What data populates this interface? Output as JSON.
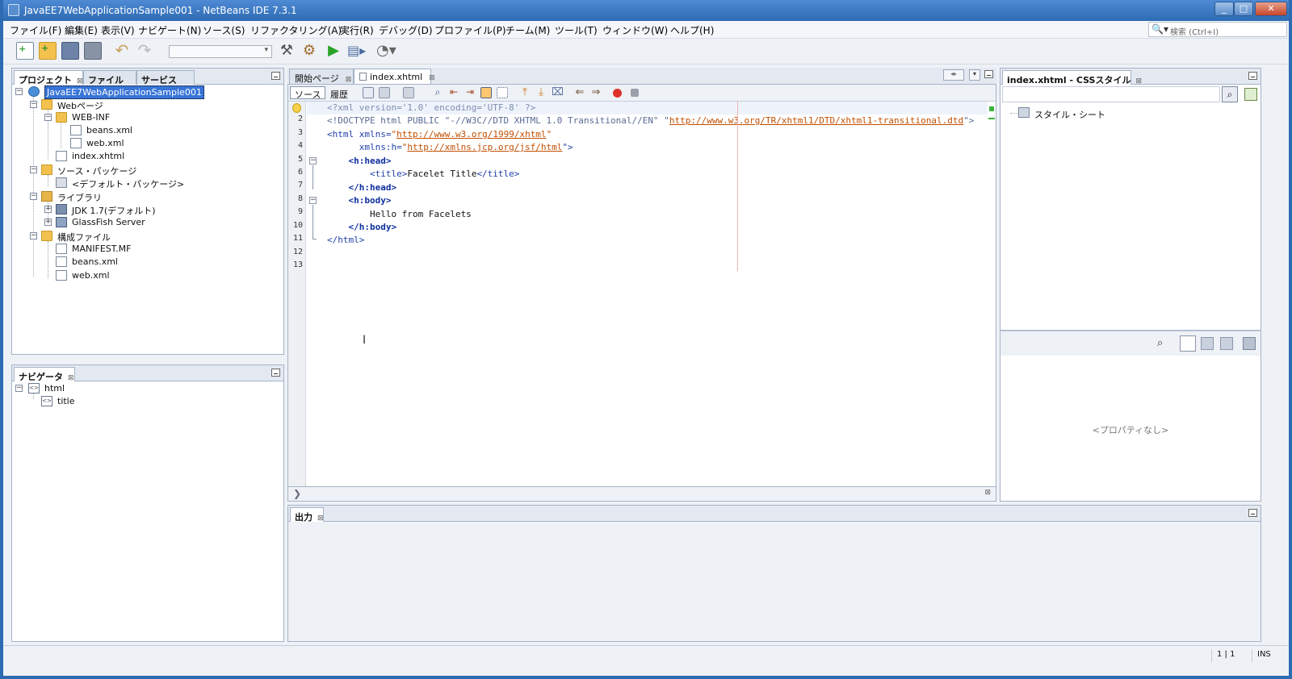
{
  "window": {
    "title": "JavaEE7WebApplicationSample001 - NetBeans IDE 7.3.1",
    "controls": [
      "_",
      "□",
      "✕"
    ]
  },
  "menu": [
    "ファイル(F)",
    "編集(E)",
    "表示(V)",
    "ナビゲート(N)",
    "ソース(S)",
    "リファクタリング(A)",
    "実行(R)",
    "デバッグ(D)",
    "プロファイル(P)",
    "チーム(M)",
    "ツール(T)",
    "ウィンドウ(W)",
    "ヘルプ(H)"
  ],
  "search": {
    "placeholder": "検索 (Ctrl+I)"
  },
  "toolbar": {
    "icons": [
      "new-file-icon",
      "new-project-icon",
      "open-project-icon",
      "close-project-icon",
      "undo-icon",
      "redo-icon",
      "config-select",
      "clean-build-icon",
      "build-icon",
      "run-icon",
      "debug-icon",
      "profile-icon"
    ],
    "config_value": ""
  },
  "projects_panel": {
    "tabs": [
      "プロジェクト",
      "ファイル",
      "サービス"
    ],
    "tree": {
      "root": "JavaEE7WebApplicationSample001",
      "web_pages": "Webページ",
      "web_inf": "WEB-INF",
      "beans_xml": "beans.xml",
      "web_xml": "web.xml",
      "index_xhtml": "index.xhtml",
      "source_packages": "ソース・パッケージ",
      "default_package": "<デフォルト・パッケージ>",
      "libraries": "ライブラリ",
      "jdk": "JDK 1.7(デフォルト)",
      "glassfish": "GlassFish Server",
      "config_files": "構成ファイル",
      "manifest": "MANIFEST.MF",
      "beans_xml2": "beans.xml",
      "web_xml2": "web.xml"
    }
  },
  "navigator_panel": {
    "tab": "ナビゲータ",
    "tree": {
      "html": "html",
      "title": "title"
    }
  },
  "editor": {
    "tabs": [
      "開始ページ",
      "index.xhtml"
    ],
    "source_label": "ソース",
    "history_label": "履歴",
    "line_numbers": [
      "1",
      "2",
      "3",
      "4",
      "5",
      "6",
      "7",
      "8",
      "9",
      "10",
      "11",
      "12",
      "13"
    ],
    "lines": {
      "l1": "<?xml version='1.0' encoding='UTF-8' ?>",
      "l2a": "<!DOCTYPE html PUBLIC \"-//W3C//DTD XHTML 1.0 Transitional//EN\" \"",
      "l2b": "http://www.w3.org/TR/xhtml1/DTD/xhtml1-transitional.dtd",
      "l2c": "\">",
      "l3a": "<html ",
      "l3b": "xmlns=",
      "l3c": "\"",
      "l3d": "http://www.w3.org/1999/xhtml",
      "l3e": "\"",
      "l4a": "      xmlns:h=",
      "l4b": "\"",
      "l4c": "http://xmlns.jcp.org/jsf/html",
      "l4d": "\">",
      "l5": "    <h:head>",
      "l6a": "        <title>",
      "l6b": "Facelet Title",
      "l6c": "</title>",
      "l7": "    </h:head>",
      "l8": "    <h:body>",
      "l9": "        Hello from Facelets",
      "l10": "    </h:body>",
      "l11": "</html>"
    }
  },
  "css_panel": {
    "tab": "index.xhtml - CSSスタイル",
    "stylesheet": "スタイル・シート",
    "no_props": "<プロパティなし>"
  },
  "output_panel": {
    "tab": "出力"
  },
  "status": {
    "position": "1 | 1",
    "mode": "INS"
  },
  "colors": {
    "titlebar": "#2d6bb3",
    "selection": "#3875d7",
    "tag": "#1f3fa8",
    "string": "#c24e00"
  }
}
